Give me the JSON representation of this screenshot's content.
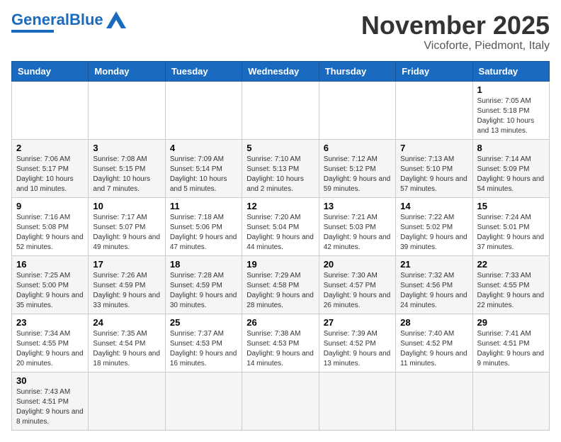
{
  "header": {
    "logo_general": "General",
    "logo_blue": "Blue",
    "month": "November 2025",
    "location": "Vicoforte, Piedmont, Italy"
  },
  "weekdays": [
    "Sunday",
    "Monday",
    "Tuesday",
    "Wednesday",
    "Thursday",
    "Friday",
    "Saturday"
  ],
  "weeks": [
    [
      {
        "day": "",
        "info": ""
      },
      {
        "day": "",
        "info": ""
      },
      {
        "day": "",
        "info": ""
      },
      {
        "day": "",
        "info": ""
      },
      {
        "day": "",
        "info": ""
      },
      {
        "day": "",
        "info": ""
      },
      {
        "day": "1",
        "info": "Sunrise: 7:05 AM\nSunset: 5:18 PM\nDaylight: 10 hours\nand 13 minutes."
      }
    ],
    [
      {
        "day": "2",
        "info": "Sunrise: 7:06 AM\nSunset: 5:17 PM\nDaylight: 10 hours\nand 10 minutes."
      },
      {
        "day": "3",
        "info": "Sunrise: 7:08 AM\nSunset: 5:15 PM\nDaylight: 10 hours\nand 7 minutes."
      },
      {
        "day": "4",
        "info": "Sunrise: 7:09 AM\nSunset: 5:14 PM\nDaylight: 10 hours\nand 5 minutes."
      },
      {
        "day": "5",
        "info": "Sunrise: 7:10 AM\nSunset: 5:13 PM\nDaylight: 10 hours\nand 2 minutes."
      },
      {
        "day": "6",
        "info": "Sunrise: 7:12 AM\nSunset: 5:12 PM\nDaylight: 9 hours\nand 59 minutes."
      },
      {
        "day": "7",
        "info": "Sunrise: 7:13 AM\nSunset: 5:10 PM\nDaylight: 9 hours\nand 57 minutes."
      },
      {
        "day": "8",
        "info": "Sunrise: 7:14 AM\nSunset: 5:09 PM\nDaylight: 9 hours\nand 54 minutes."
      }
    ],
    [
      {
        "day": "9",
        "info": "Sunrise: 7:16 AM\nSunset: 5:08 PM\nDaylight: 9 hours\nand 52 minutes."
      },
      {
        "day": "10",
        "info": "Sunrise: 7:17 AM\nSunset: 5:07 PM\nDaylight: 9 hours\nand 49 minutes."
      },
      {
        "day": "11",
        "info": "Sunrise: 7:18 AM\nSunset: 5:06 PM\nDaylight: 9 hours\nand 47 minutes."
      },
      {
        "day": "12",
        "info": "Sunrise: 7:20 AM\nSunset: 5:04 PM\nDaylight: 9 hours\nand 44 minutes."
      },
      {
        "day": "13",
        "info": "Sunrise: 7:21 AM\nSunset: 5:03 PM\nDaylight: 9 hours\nand 42 minutes."
      },
      {
        "day": "14",
        "info": "Sunrise: 7:22 AM\nSunset: 5:02 PM\nDaylight: 9 hours\nand 39 minutes."
      },
      {
        "day": "15",
        "info": "Sunrise: 7:24 AM\nSunset: 5:01 PM\nDaylight: 9 hours\nand 37 minutes."
      }
    ],
    [
      {
        "day": "16",
        "info": "Sunrise: 7:25 AM\nSunset: 5:00 PM\nDaylight: 9 hours\nand 35 minutes."
      },
      {
        "day": "17",
        "info": "Sunrise: 7:26 AM\nSunset: 4:59 PM\nDaylight: 9 hours\nand 33 minutes."
      },
      {
        "day": "18",
        "info": "Sunrise: 7:28 AM\nSunset: 4:59 PM\nDaylight: 9 hours\nand 30 minutes."
      },
      {
        "day": "19",
        "info": "Sunrise: 7:29 AM\nSunset: 4:58 PM\nDaylight: 9 hours\nand 28 minutes."
      },
      {
        "day": "20",
        "info": "Sunrise: 7:30 AM\nSunset: 4:57 PM\nDaylight: 9 hours\nand 26 minutes."
      },
      {
        "day": "21",
        "info": "Sunrise: 7:32 AM\nSunset: 4:56 PM\nDaylight: 9 hours\nand 24 minutes."
      },
      {
        "day": "22",
        "info": "Sunrise: 7:33 AM\nSunset: 4:55 PM\nDaylight: 9 hours\nand 22 minutes."
      }
    ],
    [
      {
        "day": "23",
        "info": "Sunrise: 7:34 AM\nSunset: 4:55 PM\nDaylight: 9 hours\nand 20 minutes."
      },
      {
        "day": "24",
        "info": "Sunrise: 7:35 AM\nSunset: 4:54 PM\nDaylight: 9 hours\nand 18 minutes."
      },
      {
        "day": "25",
        "info": "Sunrise: 7:37 AM\nSunset: 4:53 PM\nDaylight: 9 hours\nand 16 minutes."
      },
      {
        "day": "26",
        "info": "Sunrise: 7:38 AM\nSunset: 4:53 PM\nDaylight: 9 hours\nand 14 minutes."
      },
      {
        "day": "27",
        "info": "Sunrise: 7:39 AM\nSunset: 4:52 PM\nDaylight: 9 hours\nand 13 minutes."
      },
      {
        "day": "28",
        "info": "Sunrise: 7:40 AM\nSunset: 4:52 PM\nDaylight: 9 hours\nand 11 minutes."
      },
      {
        "day": "29",
        "info": "Sunrise: 7:41 AM\nSunset: 4:51 PM\nDaylight: 9 hours\nand 9 minutes."
      }
    ],
    [
      {
        "day": "30",
        "info": "Sunrise: 7:43 AM\nSunset: 4:51 PM\nDaylight: 9 hours\nand 8 minutes."
      },
      {
        "day": "",
        "info": ""
      },
      {
        "day": "",
        "info": ""
      },
      {
        "day": "",
        "info": ""
      },
      {
        "day": "",
        "info": ""
      },
      {
        "day": "",
        "info": ""
      },
      {
        "day": "",
        "info": ""
      }
    ]
  ]
}
